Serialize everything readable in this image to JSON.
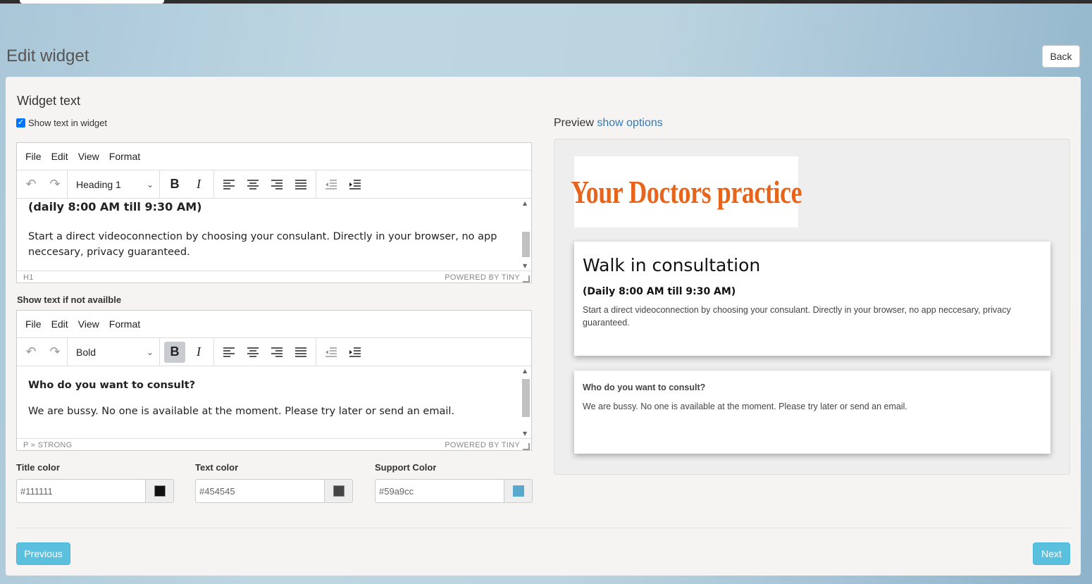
{
  "page": {
    "title": "Edit widget",
    "back_label": "Back"
  },
  "form": {
    "section_title": "Widget text",
    "show_text_label": "Show text in widget",
    "show_text_checked": true,
    "not_available_label": "Show text if not availble"
  },
  "editor1": {
    "menu": [
      "File",
      "Edit",
      "View",
      "Format"
    ],
    "block_format": "Heading 1",
    "content": {
      "heading": "(daily 8:00 AM till 9:30 AM)",
      "paragraph": "Start a direct videoconnection by choosing your consulant.  Directly in your browser, no app neccesary, privacy guaranteed."
    },
    "status_path": "H1",
    "powered_by": "POWERED BY TINY"
  },
  "editor2": {
    "menu": [
      "File",
      "Edit",
      "View",
      "Format"
    ],
    "block_format": "Bold",
    "content": {
      "bold": "Who do you want to consult?",
      "paragraph": "We are bussy. No one is available at the moment. Please try later or send an email."
    },
    "status_path": "P » STRONG",
    "powered_by": "POWERED BY TINY"
  },
  "colors": {
    "title": {
      "label": "Title color",
      "value": "#111111",
      "swatch": "#111111"
    },
    "text": {
      "label": "Text color",
      "value": "#454545",
      "swatch": "#454545"
    },
    "support": {
      "label": "Support Color",
      "value": "#59a9cc",
      "swatch": "#59a9cc"
    }
  },
  "preview": {
    "label": "Preview",
    "options_link": "show options",
    "logo_text": "Your Doctors practice",
    "logo_color": "#e8641a",
    "card1": {
      "title": "Walk in consultation",
      "hours": "(Daily 8:00 AM till 9:30 AM)",
      "text": "Start a direct videoconnection by choosing your consulant.  Directly in your browser, no app neccesary, privacy guaranteed."
    },
    "card2": {
      "title": "Who do you want to consult?",
      "text": "We are bussy. No one is available at the moment. Please try later or send an email."
    }
  },
  "nav": {
    "previous_label": "Previous",
    "next_label": "Next"
  },
  "icons": [
    "undo-icon",
    "redo-icon",
    "chevron-down-icon",
    "bold-icon",
    "italic-icon",
    "align-left-icon",
    "align-center-icon",
    "align-right-icon",
    "align-justify-icon",
    "outdent-icon",
    "indent-icon"
  ]
}
